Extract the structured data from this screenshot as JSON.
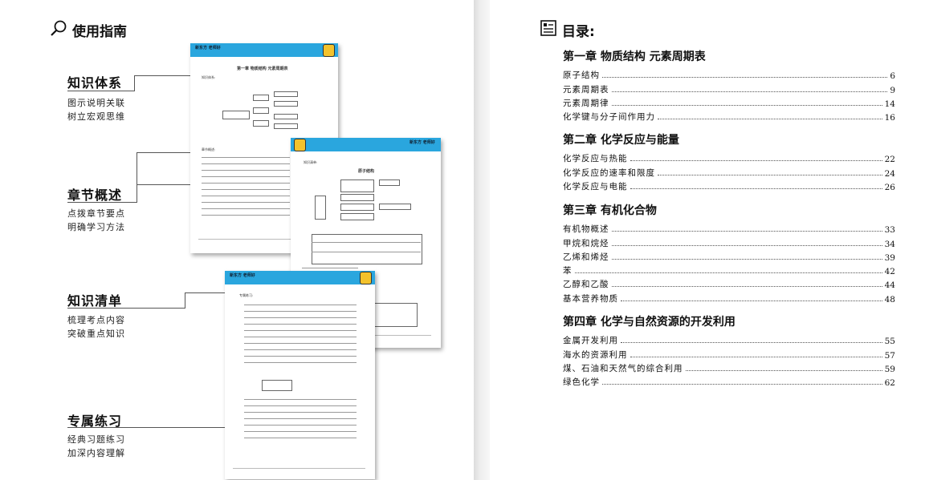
{
  "guide": {
    "title": "使用指南",
    "sections": [
      {
        "title": "知识体系",
        "lines": [
          "图示说明关联",
          "树立宏观思维"
        ]
      },
      {
        "title": "章节概述",
        "lines": [
          "点拨章节要点",
          "明确学习方法"
        ]
      },
      {
        "title": "知识清单",
        "lines": [
          "梳理考点内容",
          "突破重点知识"
        ]
      },
      {
        "title": "专属练习",
        "lines": [
          "经典习题练习",
          "加深内容理解"
        ]
      }
    ],
    "thumb1": {
      "brand": "新东方 老师好",
      "chapter": "第一章 物质结构 元素周期表",
      "label1": "知识体系:",
      "label2": "章节概述:"
    },
    "thumb2": {
      "brand": "新东方 老师好",
      "label": "知识清单:",
      "heading": "原子结构"
    },
    "thumb3": {
      "brand": "新东方 老师好",
      "label": "专属练习:"
    }
  },
  "toc": {
    "title": "目录:",
    "chapters": [
      {
        "title": "第一章  物质结构  元素周期表",
        "entries": [
          {
            "label": "原子结构",
            "page": "6"
          },
          {
            "label": "元素周期表",
            "page": "9"
          },
          {
            "label": "元素周期律",
            "page": "14"
          },
          {
            "label": "化学键与分子间作用力",
            "page": "16"
          }
        ]
      },
      {
        "title": "第二章  化学反应与能量",
        "entries": [
          {
            "label": "化学反应与热能",
            "page": "22"
          },
          {
            "label": "化学反应的速率和限度",
            "page": "24"
          },
          {
            "label": "化学反应与电能",
            "page": "26"
          }
        ]
      },
      {
        "title": "第三章  有机化合物",
        "entries": [
          {
            "label": "有机物概述",
            "page": "33"
          },
          {
            "label": "甲烷和烷烃",
            "page": "34"
          },
          {
            "label": "乙烯和烯烃",
            "page": "39"
          },
          {
            "label": "苯",
            "page": "42"
          },
          {
            "label": "乙醇和乙酸",
            "page": "44"
          },
          {
            "label": "基本营养物质",
            "page": "48"
          }
        ]
      },
      {
        "title": "第四章  化学与自然资源的开发利用",
        "entries": [
          {
            "label": "金属开发利用",
            "page": "55"
          },
          {
            "label": "海水的资源利用",
            "page": "57"
          },
          {
            "label": "煤、石油和天然气的综合利用",
            "page": "59"
          },
          {
            "label": "绿色化学",
            "page": "62"
          }
        ]
      }
    ]
  }
}
